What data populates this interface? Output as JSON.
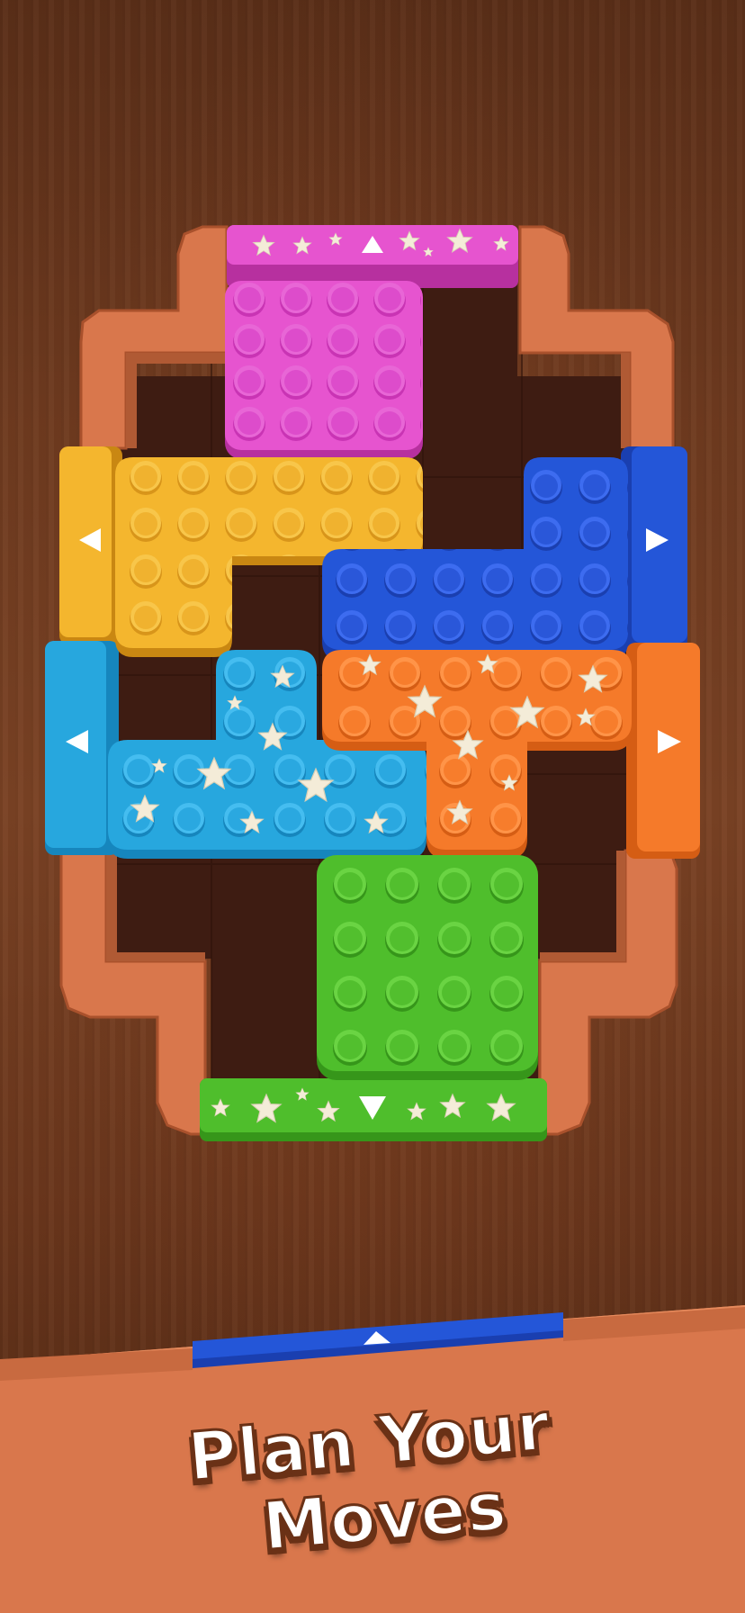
{
  "title": {
    "line1": "Plan Your",
    "line2": "Moves"
  },
  "board": {
    "theme": "wood",
    "frame_color": "#d9774c",
    "floor_color": "#3e1c12"
  },
  "blocks": [
    {
      "name": "pink-block",
      "color": "#e654cf",
      "studs": 16,
      "stars": false
    },
    {
      "name": "yellow-block",
      "color": "#f4b62e",
      "studs": 16,
      "stars": false
    },
    {
      "name": "blue-block",
      "color": "#2456d8",
      "studs": 16,
      "stars": false
    },
    {
      "name": "cyan-block",
      "color": "#27a7de",
      "studs": 16,
      "stars": true
    },
    {
      "name": "orange-block",
      "color": "#f57a2a",
      "studs": 16,
      "stars": true
    },
    {
      "name": "green-block",
      "color": "#4fbe2c",
      "studs": 16,
      "stars": false
    }
  ],
  "exits": [
    {
      "name": "pink-exit-gate",
      "color": "#e654cf",
      "direction": "up",
      "arrow": "▲"
    },
    {
      "name": "yellow-exit-gate",
      "color": "#f4b62e",
      "direction": "left",
      "arrow": "◀"
    },
    {
      "name": "blue-exit-gate",
      "color": "#2456d8",
      "direction": "right",
      "arrow": "▶"
    },
    {
      "name": "cyan-exit-gate",
      "color": "#27a7de",
      "direction": "left",
      "arrow": "◀"
    },
    {
      "name": "orange-exit-gate",
      "color": "#f57a2a",
      "direction": "right",
      "arrow": "▶"
    },
    {
      "name": "green-exit-gate",
      "color": "#4fbe2c",
      "direction": "down",
      "arrow": "▼"
    },
    {
      "name": "shelf-blue-gate",
      "color": "#2456d8",
      "direction": "up",
      "arrow": "▲"
    }
  ],
  "icons": [
    "star-icon",
    "arrow-up-icon",
    "arrow-down-icon",
    "arrow-left-icon",
    "arrow-right-icon"
  ]
}
